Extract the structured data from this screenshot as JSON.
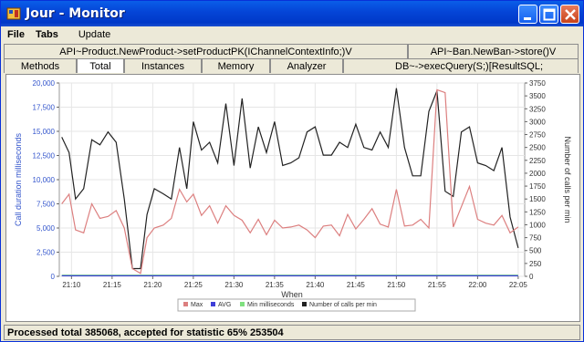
{
  "window": {
    "title": "Jour - Monitor"
  },
  "menu": [
    "File",
    "Tabs",
    "Update"
  ],
  "method_tabs": {
    "row1": [
      "API~Product.NewProduct->setProductPK(IChannelContextInfo;)V",
      "API~Ban.NewBan->store()V"
    ],
    "row2": [
      "Methods",
      "Total",
      "Instances",
      "Memory",
      "Analyzer",
      "DB~->execQuery(S;)[ResultSQL;"
    ]
  },
  "status": {
    "text": "Processed total 385068, accepted for statistic  65% 253504"
  },
  "colors": {
    "max": "#dc7f7f",
    "avg": "#3f3fd8",
    "min": "#7fe07f",
    "calls": "#222222",
    "left_axis": "#3355cc",
    "right_axis": "#333333"
  },
  "chart_data": {
    "type": "line",
    "xlabel": "When",
    "ylabel_left": "Call duration milliseconds",
    "ylabel_right": "Number of calls per min",
    "ylim_left": [
      0,
      20000
    ],
    "ylim_right": [
      0,
      3750
    ],
    "x_range_minutes": [
      8.5,
      65.8
    ],
    "x_ticks": [
      "21:10",
      "21:15",
      "21:20",
      "21:25",
      "21:30",
      "21:35",
      "21:40",
      "21:45",
      "21:50",
      "21:55",
      "22:00",
      "22:05"
    ],
    "y_ticks_left": [
      "0",
      "2,500",
      "5,000",
      "7,500",
      "10,000",
      "12,500",
      "15,000",
      "17,500",
      "20,000"
    ],
    "y_ticks_right": [
      "0",
      "250",
      "500",
      "750",
      "1000",
      "1250",
      "1500",
      "1750",
      "2000",
      "2250",
      "2500",
      "2750",
      "3000",
      "3250",
      "3500",
      "3750"
    ],
    "legend": [
      "Max",
      "AVG",
      "Min milliseconds",
      "Number of calls per min"
    ],
    "legend_position": "bottom",
    "grid": true,
    "series": [
      {
        "name": "Number of calls per min",
        "axis": "right",
        "color": "#222222",
        "x": [
          8.8,
          9.7,
          10.5,
          11.5,
          12.5,
          13.5,
          14.5,
          15.5,
          16.5,
          17.5,
          18.5,
          19.3,
          20.2,
          21.3,
          22.3,
          23.3,
          24.2,
          25.0,
          26.0,
          27.0,
          28.0,
          29.0,
          30.0,
          31.0,
          32.0,
          33.0,
          34.0,
          35.0,
          36.0,
          37.0,
          38.0,
          39.0,
          40.0,
          41.0,
          42.0,
          43.0,
          44.0,
          45.0,
          46.0,
          47.0,
          48.0,
          49.0,
          50.0,
          51.0,
          52.0,
          53.0,
          54.0,
          55.0,
          56.0,
          57.0,
          58.0,
          59.0,
          60.0,
          61.0,
          62.0,
          63.0,
          64.0,
          65.0
        ],
        "y": [
          2700,
          2400,
          1500,
          1700,
          2650,
          2550,
          2800,
          2600,
          1500,
          150,
          150,
          1200,
          1700,
          1600,
          1500,
          2500,
          1700,
          3000,
          2450,
          2600,
          2200,
          3350,
          2150,
          3450,
          2100,
          2900,
          2400,
          3000,
          2150,
          2200,
          2300,
          2800,
          2900,
          2350,
          2350,
          2600,
          2500,
          2950,
          2500,
          2450,
          2800,
          2500,
          3650,
          2500,
          1950,
          1950,
          3200,
          3600,
          1650,
          1550,
          2800,
          2900,
          2200,
          2150,
          2050,
          2500,
          1150,
          550
        ]
      },
      {
        "name": "Max",
        "axis": "left",
        "color": "#dc7f7f",
        "x": [
          8.8,
          9.7,
          10.5,
          11.5,
          12.5,
          13.5,
          14.5,
          15.5,
          16.5,
          17.5,
          18.5,
          19.3,
          20.2,
          21.3,
          22.3,
          23.3,
          24.2,
          25.0,
          26.0,
          27.0,
          28.0,
          29.0,
          30.0,
          31.0,
          32.0,
          33.0,
          34.0,
          35.0,
          36.0,
          37.0,
          38.0,
          39.0,
          40.0,
          41.0,
          42.0,
          43.0,
          44.0,
          45.0,
          46.0,
          47.0,
          48.0,
          49.0,
          50.0,
          51.0,
          52.0,
          53.0,
          54.0,
          55.0,
          56.0,
          57.0,
          58.0,
          59.0,
          60.0,
          61.0,
          62.0,
          63.0,
          64.0,
          65.0
        ],
        "y": [
          7500,
          8500,
          4800,
          4500,
          7500,
          6000,
          6200,
          6800,
          5000,
          800,
          300,
          4000,
          5000,
          5300,
          6000,
          9000,
          7700,
          8500,
          6300,
          7300,
          5500,
          7300,
          6300,
          5800,
          4500,
          5900,
          4300,
          5800,
          5000,
          5100,
          5300,
          4800,
          4000,
          5200,
          5300,
          4200,
          6400,
          4900,
          5900,
          7000,
          5400,
          5100,
          9000,
          5200,
          5300,
          5900,
          5000,
          19300,
          19000,
          5100,
          7200,
          9300,
          5900,
          5500,
          5300,
          6300,
          4500,
          5100
        ]
      },
      {
        "name": "Min milliseconds",
        "axis": "left",
        "color": "#7fe07f",
        "x": [
          8.8,
          65.0
        ],
        "y": [
          120,
          120
        ]
      },
      {
        "name": "AVG",
        "axis": "left",
        "color": "#3f3fd8",
        "x": [
          8.8,
          65.0
        ],
        "y": [
          60,
          60
        ]
      }
    ]
  }
}
